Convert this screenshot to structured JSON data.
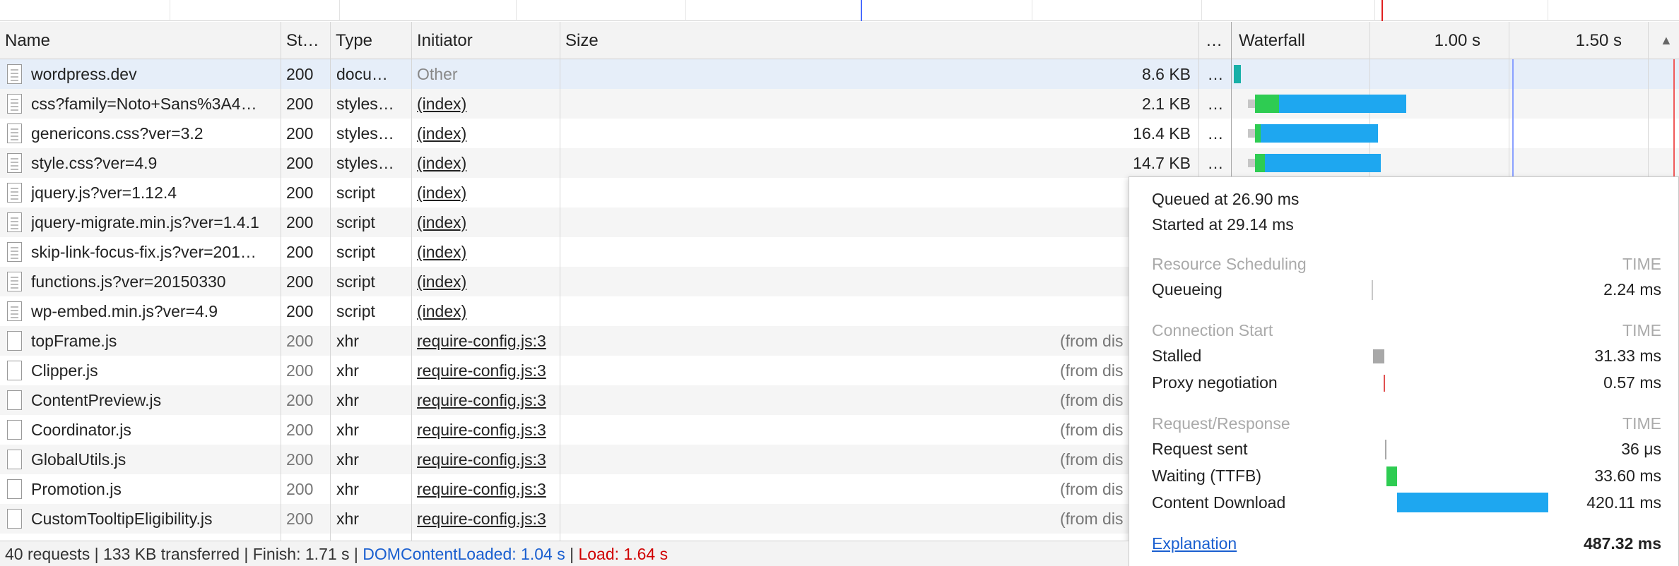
{
  "header": {
    "name": "Name",
    "status": "St…",
    "type": "Type",
    "initiator": "Initiator",
    "size": "Size",
    "more": "…",
    "waterfall": "Waterfall",
    "tick1": "1.00 s",
    "tick2": "1.50 s",
    "sort_arrow": "▲"
  },
  "rows": [
    {
      "name": "wordpress.dev",
      "status": "200",
      "type": "docu…",
      "initiator": "Other",
      "size": "8.6 KB",
      "more": "…"
    },
    {
      "name": "css?family=Noto+Sans%3A4…",
      "status": "200",
      "type": "styles…",
      "initiator": "(index)",
      "size": "2.1 KB",
      "more": "…"
    },
    {
      "name": "genericons.css?ver=3.2",
      "status": "200",
      "type": "styles…",
      "initiator": "(index)",
      "size": "16.4 KB",
      "more": "…"
    },
    {
      "name": "style.css?ver=4.9",
      "status": "200",
      "type": "styles…",
      "initiator": "(index)",
      "size": "14.7 KB",
      "more": "…"
    },
    {
      "name": "jquery.js?ver=1.12.4",
      "status": "200",
      "type": "script",
      "initiator": "(index)"
    },
    {
      "name": "jquery-migrate.min.js?ver=1.4.1",
      "status": "200",
      "type": "script",
      "initiator": "(index)"
    },
    {
      "name": "skip-link-focus-fix.js?ver=201…",
      "status": "200",
      "type": "script",
      "initiator": "(index)"
    },
    {
      "name": "functions.js?ver=20150330",
      "status": "200",
      "type": "script",
      "initiator": "(index)"
    },
    {
      "name": "wp-embed.min.js?ver=4.9",
      "status": "200",
      "type": "script",
      "initiator": "(index)"
    },
    {
      "name": "topFrame.js",
      "status": "200",
      "type": "xhr",
      "initiator": "require-config.js:3",
      "size": "(from dis"
    },
    {
      "name": "Clipper.js",
      "status": "200",
      "type": "xhr",
      "initiator": "require-config.js:3",
      "size": "(from dis"
    },
    {
      "name": "ContentPreview.js",
      "status": "200",
      "type": "xhr",
      "initiator": "require-config.js:3",
      "size": "(from dis"
    },
    {
      "name": "Coordinator.js",
      "status": "200",
      "type": "xhr",
      "initiator": "require-config.js:3",
      "size": "(from dis"
    },
    {
      "name": "GlobalUtils.js",
      "status": "200",
      "type": "xhr",
      "initiator": "require-config.js:3",
      "size": "(from dis"
    },
    {
      "name": "Promotion.js",
      "status": "200",
      "type": "xhr",
      "initiator": "require-config.js:3",
      "size": "(from dis"
    },
    {
      "name": "CustomTooltipEligibility.js",
      "status": "200",
      "type": "xhr",
      "initiator": "require-config.js:3",
      "size": "(from dis"
    }
  ],
  "timing_popup": {
    "queued_at": "Queued at 26.90 ms",
    "started_at": "Started at 29.14 ms",
    "sections": [
      {
        "title": "Resource Scheduling",
        "time_label": "TIME",
        "items": [
          {
            "label": "Queueing",
            "value": "2.24 ms"
          }
        ]
      },
      {
        "title": "Connection Start",
        "time_label": "TIME",
        "items": [
          {
            "label": "Stalled",
            "value": "31.33 ms"
          },
          {
            "label": "Proxy negotiation",
            "value": "0.57 ms"
          }
        ]
      },
      {
        "title": "Request/Response",
        "time_label": "TIME",
        "items": [
          {
            "label": "Request sent",
            "value": "36 μs"
          },
          {
            "label": "Waiting (TTFB)",
            "value": "33.60 ms"
          },
          {
            "label": "Content Download",
            "value": "420.11 ms"
          }
        ]
      }
    ],
    "explanation": "Explanation",
    "total": "487.32 ms"
  },
  "status_bar": {
    "summary": "40 requests | 133 KB transferred | Finish: 1.71 s |",
    "dom_content_loaded": "DOMContentLoaded: 1.04 s",
    "sep": "|",
    "load": "Load: 1.64 s"
  },
  "colors": {
    "waiting": "#2ecc52",
    "download": "#1ea7f0",
    "queue": "#b0b0b0",
    "dom_line": "#4a6cff",
    "load_line": "#e02020"
  }
}
